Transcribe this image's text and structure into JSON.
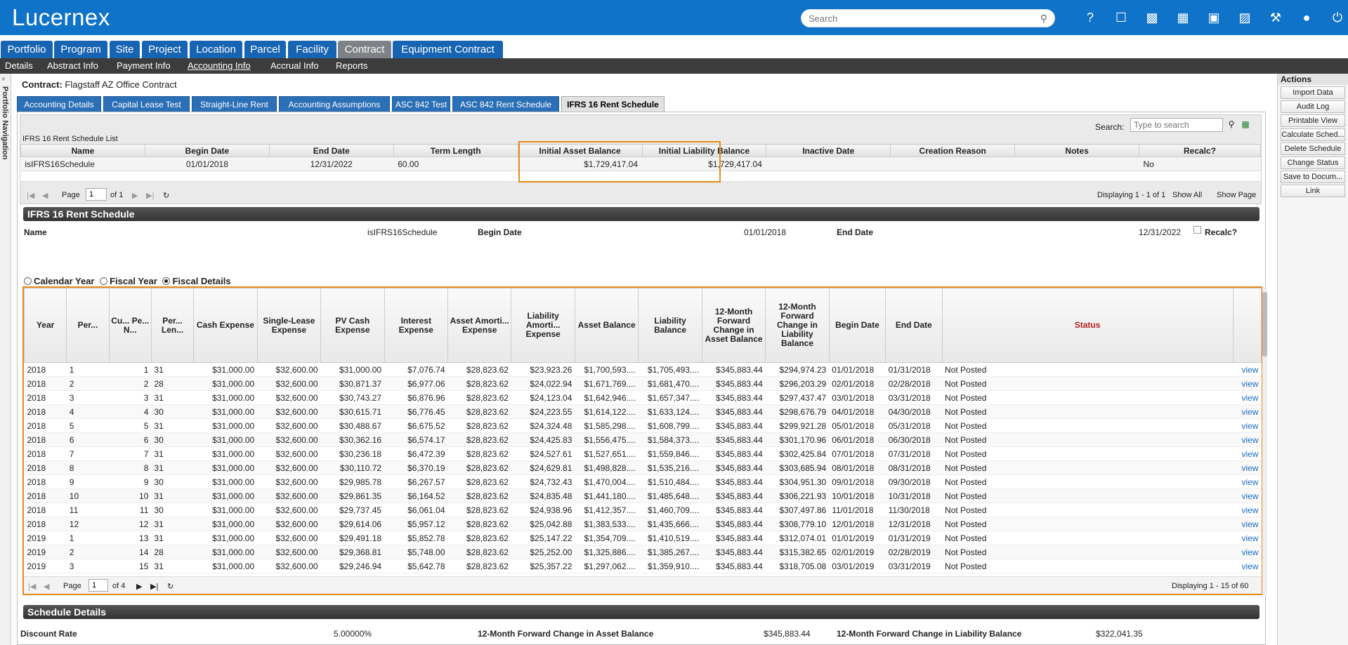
{
  "app": {
    "logo": "Lucernex",
    "search_placeholder": "Search"
  },
  "top_icons": [
    "help-icon",
    "bookmark-icon",
    "chart-icon",
    "calendar-icon",
    "monitor-icon",
    "briefcase-icon",
    "tools-icon",
    "user-icon",
    "power-icon"
  ],
  "nav_tabs": [
    "Portfolio",
    "Program",
    "Site",
    "Project",
    "Location",
    "Parcel",
    "Facility",
    "Contract",
    "Equipment Contract"
  ],
  "sub_nav": [
    "Details",
    "Abstract Info",
    "Payment Info",
    "Accounting Info",
    "Accrual Info",
    "Reports"
  ],
  "left_nav_label": "Portfolio Navigation",
  "contract": {
    "label": "Contract:",
    "name": "Flagstaff AZ Office Contract"
  },
  "sub_tabs": [
    "Accounting Details",
    "Capital Lease Test",
    "Straight-Line Rent",
    "Accounting Assumptions",
    "ASC 842 Test",
    "ASC 842 Rent Schedule",
    "IFRS 16 Rent Schedule"
  ],
  "list": {
    "search_label": "Search:",
    "search_placeholder": "Type to search",
    "title": "IFRS 16 Rent Schedule List",
    "columns": [
      "Name",
      "Begin Date",
      "End Date",
      "Term Length",
      "Initial Asset Balance",
      "Initial Liability Balance",
      "Inactive Date",
      "Creation Reason",
      "Notes",
      "Recalc?"
    ],
    "rows": [
      [
        "isIFRS16Schedule",
        "01/01/2018",
        "12/31/2022",
        "60.00",
        "$1,729,417.04",
        "$1,729,417.04",
        "",
        "",
        "",
        "No"
      ]
    ],
    "pager": {
      "page_label": "Page",
      "page": "1",
      "of": "of 1",
      "displaying": "Displaying 1 - 1 of 1",
      "show_all": "Show All",
      "show_page": "Show Page"
    }
  },
  "schedule": {
    "section_title": "IFRS 16 Rent Schedule",
    "name_label": "Name",
    "name_value": "isIFRS16Schedule",
    "begin_label": "Begin Date",
    "begin_value": "01/01/2018",
    "end_label": "End Date",
    "end_value": "12/31/2022",
    "recalc_label": "Recalc?",
    "radio_options": [
      "Calendar Year",
      "Fiscal Year",
      "Fiscal Details"
    ],
    "radio_selected": "Fiscal Details",
    "columns": [
      "Year",
      "Per...",
      "Cu... Pe... N...",
      "Per... Len...",
      "Cash Expense",
      "Single-Lease Expense",
      "PV Cash Expense",
      "Interest Expense",
      "Asset Amorti... Expense",
      "Liability Amorti... Expense",
      "Asset Balance",
      "Liability Balance",
      "12-Month Forward Change in Asset Balance",
      "12-Month Forward Change in Liability Balance",
      "Begin Date",
      "End Date",
      "Status",
      ""
    ],
    "rows": [
      [
        "2018",
        "1",
        "1",
        "31",
        "$31,000.00",
        "$32,600.00",
        "$31,000.00",
        "$7,076.74",
        "$28,823.62",
        "$23,923.26",
        "$1,700,593....",
        "$1,705,493....",
        "$345,883.44",
        "$294,974.23",
        "01/01/2018",
        "01/31/2018",
        "Not Posted",
        "view"
      ],
      [
        "2018",
        "2",
        "2",
        "28",
        "$31,000.00",
        "$32,600.00",
        "$30,871.37",
        "$6,977.06",
        "$28,823.62",
        "$24,022.94",
        "$1,671,769....",
        "$1,681,470....",
        "$345,883.44",
        "$296,203.29",
        "02/01/2018",
        "02/28/2018",
        "Not Posted",
        "view"
      ],
      [
        "2018",
        "3",
        "3",
        "31",
        "$31,000.00",
        "$32,600.00",
        "$30,743.27",
        "$6,876.96",
        "$28,823.62",
        "$24,123.04",
        "$1,642,946....",
        "$1,657,347....",
        "$345,883.44",
        "$297,437.47",
        "03/01/2018",
        "03/31/2018",
        "Not Posted",
        "view"
      ],
      [
        "2018",
        "4",
        "4",
        "30",
        "$31,000.00",
        "$32,600.00",
        "$30,615.71",
        "$6,776.45",
        "$28,823.62",
        "$24,223.55",
        "$1,614,122....",
        "$1,633,124....",
        "$345,883.44",
        "$298,676.79",
        "04/01/2018",
        "04/30/2018",
        "Not Posted",
        "view"
      ],
      [
        "2018",
        "5",
        "5",
        "31",
        "$31,000.00",
        "$32,600.00",
        "$30,488.67",
        "$6,675.52",
        "$28,823.62",
        "$24,324.48",
        "$1,585,298....",
        "$1,608,799....",
        "$345,883.44",
        "$299,921.28",
        "05/01/2018",
        "05/31/2018",
        "Not Posted",
        "view"
      ],
      [
        "2018",
        "6",
        "6",
        "30",
        "$31,000.00",
        "$32,600.00",
        "$30,362.16",
        "$6,574.17",
        "$28,823.62",
        "$24,425.83",
        "$1,556,475....",
        "$1,584,373....",
        "$345,883.44",
        "$301,170.96",
        "06/01/2018",
        "06/30/2018",
        "Not Posted",
        "view"
      ],
      [
        "2018",
        "7",
        "7",
        "31",
        "$31,000.00",
        "$32,600.00",
        "$30,236.18",
        "$6,472.39",
        "$28,823.62",
        "$24,527.61",
        "$1,527,651....",
        "$1,559,846....",
        "$345,883.44",
        "$302,425.84",
        "07/01/2018",
        "07/31/2018",
        "Not Posted",
        "view"
      ],
      [
        "2018",
        "8",
        "8",
        "31",
        "$31,000.00",
        "$32,600.00",
        "$30,110.72",
        "$6,370.19",
        "$28,823.62",
        "$24,629.81",
        "$1,498,828....",
        "$1,535,216....",
        "$345,883.44",
        "$303,685.94",
        "08/01/2018",
        "08/31/2018",
        "Not Posted",
        "view"
      ],
      [
        "2018",
        "9",
        "9",
        "30",
        "$31,000.00",
        "$32,600.00",
        "$29,985.78",
        "$6,267.57",
        "$28,823.62",
        "$24,732.43",
        "$1,470,004....",
        "$1,510,484....",
        "$345,883.44",
        "$304,951.30",
        "09/01/2018",
        "09/30/2018",
        "Not Posted",
        "view"
      ],
      [
        "2018",
        "10",
        "10",
        "31",
        "$31,000.00",
        "$32,600.00",
        "$29,861.35",
        "$6,164.52",
        "$28,823.62",
        "$24,835.48",
        "$1,441,180....",
        "$1,485,648....",
        "$345,883.44",
        "$306,221.93",
        "10/01/2018",
        "10/31/2018",
        "Not Posted",
        "view"
      ],
      [
        "2018",
        "11",
        "11",
        "30",
        "$31,000.00",
        "$32,600.00",
        "$29,737.45",
        "$6,061.04",
        "$28,823.62",
        "$24,938.96",
        "$1,412,357....",
        "$1,460,709....",
        "$345,883.44",
        "$307,497.86",
        "11/01/2018",
        "11/30/2018",
        "Not Posted",
        "view"
      ],
      [
        "2018",
        "12",
        "12",
        "31",
        "$31,000.00",
        "$32,600.00",
        "$29,614.06",
        "$5,957.12",
        "$28,823.62",
        "$25,042.88",
        "$1,383,533....",
        "$1,435,666....",
        "$345,883.44",
        "$308,779.10",
        "12/01/2018",
        "12/31/2018",
        "Not Posted",
        "view"
      ],
      [
        "2019",
        "1",
        "13",
        "31",
        "$31,000.00",
        "$32,600.00",
        "$29,491.18",
        "$5,852.78",
        "$28,823.62",
        "$25,147.22",
        "$1,354,709....",
        "$1,410,519....",
        "$345,883.44",
        "$312,074.01",
        "01/01/2019",
        "01/31/2019",
        "Not Posted",
        "view"
      ],
      [
        "2019",
        "2",
        "14",
        "28",
        "$31,000.00",
        "$32,600.00",
        "$29,368.81",
        "$5,748.00",
        "$28,823.62",
        "$25,252.00",
        "$1,325,886....",
        "$1,385,267....",
        "$345,883.44",
        "$315,382.65",
        "02/01/2019",
        "02/28/2019",
        "Not Posted",
        "view"
      ],
      [
        "2019",
        "3",
        "15",
        "31",
        "$31,000.00",
        "$32,600.00",
        "$29,246.94",
        "$5,642.78",
        "$28,823.62",
        "$25,357.22",
        "$1,297,062....",
        "$1,359,910....",
        "$345,883.44",
        "$318,705.08",
        "03/01/2019",
        "03/31/2019",
        "Not Posted",
        "view"
      ]
    ],
    "pager": {
      "page_label": "Page",
      "page": "1",
      "of": "of 4",
      "displaying": "Displaying 1 - 15 of 60"
    }
  },
  "details": {
    "section_title": "Schedule Details",
    "discount_label": "Discount Rate",
    "discount_value": "5.00000%",
    "asset_change_label": "12-Month Forward Change in Asset Balance",
    "asset_change_value": "$345,883.44",
    "liab_change_label": "12-Month Forward Change in Liability Balance",
    "liab_change_value": "$322,041.35"
  },
  "actions": {
    "title": "Actions",
    "buttons": [
      "Import Data",
      "Audit Log",
      "Printable View",
      "Calculate Sched...",
      "Delete Schedule",
      "Change Status",
      "Save to Docum...",
      "Link"
    ]
  },
  "colors": {
    "brand": "#0f73c9",
    "highlight": "#e78a1a",
    "status_header": "#b52020"
  }
}
